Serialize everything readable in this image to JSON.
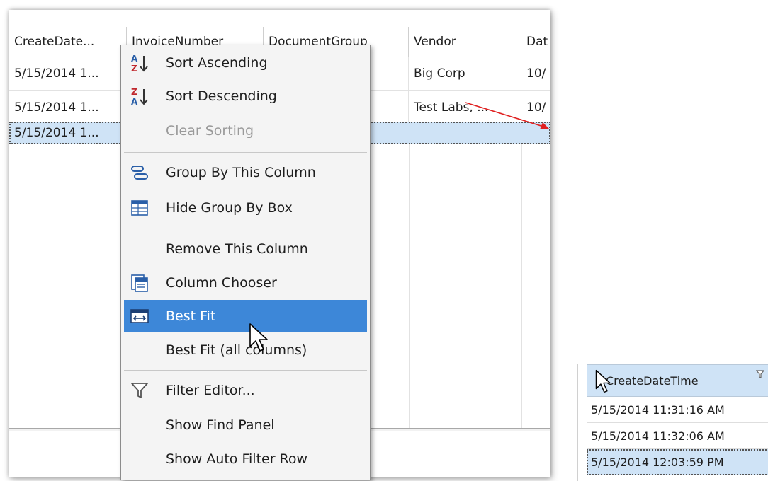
{
  "grid": {
    "columns": [
      "CreateDate...",
      "InvoiceNumber",
      "DocumentGroup",
      "Vendor",
      "Dat"
    ],
    "rows": [
      [
        "5/15/2014 1...",
        "",
        "",
        "Big Corp",
        "10/"
      ],
      [
        "5/15/2014 1...",
        "",
        "",
        "Test Labs, ...",
        "10/"
      ],
      [
        "5/15/2014 1...",
        "",
        "",
        "",
        ""
      ]
    ]
  },
  "menu": {
    "items": [
      {
        "label": "Sort Ascending",
        "icon": "sort-ascending-icon",
        "state": "normal"
      },
      {
        "label": "Sort Descending",
        "icon": "sort-descending-icon",
        "state": "normal"
      },
      {
        "label": "Clear Sorting",
        "icon": "",
        "state": "disabled"
      },
      {
        "label": "Group By This Column",
        "icon": "group-by-icon",
        "state": "normal"
      },
      {
        "label": "Hide Group By Box",
        "icon": "group-box-icon",
        "state": "normal"
      },
      {
        "label": "Remove This Column",
        "icon": "",
        "state": "normal"
      },
      {
        "label": "Column Chooser",
        "icon": "column-chooser-icon",
        "state": "normal"
      },
      {
        "label": "Best Fit",
        "icon": "best-fit-icon",
        "state": "highlighted"
      },
      {
        "label": "Best Fit (all columns)",
        "icon": "",
        "state": "normal"
      },
      {
        "label": "Filter Editor...",
        "icon": "filter-icon",
        "state": "normal"
      },
      {
        "label": "Show Find Panel",
        "icon": "",
        "state": "normal"
      },
      {
        "label": "Show Auto Filter Row",
        "icon": "",
        "state": "normal"
      }
    ]
  },
  "inset": {
    "header": "CreateDateTime",
    "rows": [
      "5/15/2014 11:31:16 AM",
      "5/15/2014 11:32:06 AM",
      "5/15/2014 12:03:59 PM"
    ]
  },
  "colors": {
    "selection": "#cfe3f6",
    "menu_highlight": "#3d87d8",
    "arrow": "#e02020",
    "icon_blue": "#2a5fa8",
    "icon_red": "#c0282d"
  }
}
